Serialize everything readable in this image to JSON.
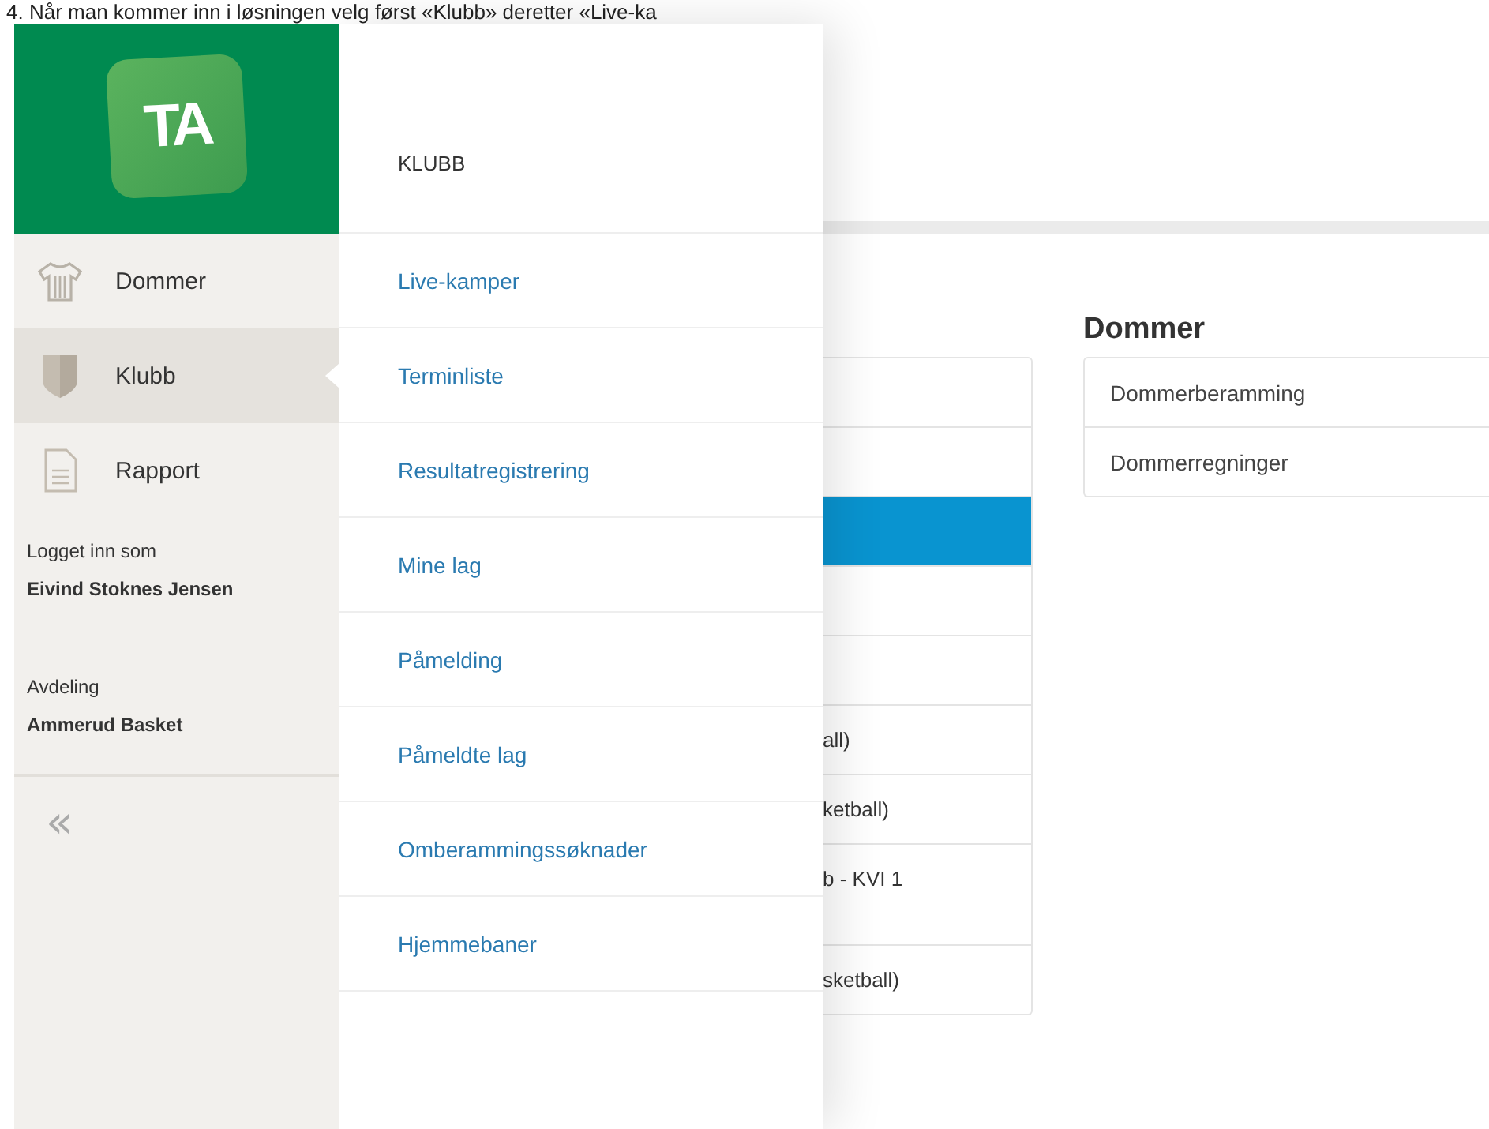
{
  "caption": "4. Når man kommer inn i løsningen velg først «Klubb» deretter «Live-ka",
  "logo": {
    "text": "TA"
  },
  "sidebar": {
    "items": [
      {
        "label": "Dommer",
        "selected": false
      },
      {
        "label": "Klubb",
        "selected": true
      },
      {
        "label": "Rapport",
        "selected": false
      }
    ],
    "user": {
      "label": "Logget inn som",
      "name": "Eivind Stoknes Jensen"
    },
    "department": {
      "label": "Avdeling",
      "name": "Ammerud Basket"
    },
    "collapse": "«"
  },
  "flyout": {
    "title": "KLUBB",
    "items": [
      "Live-kamper",
      "Terminliste",
      "Resultatregistrering",
      "Mine lag",
      "Påmelding",
      "Påmeldte lag",
      "Omberammingssøknader",
      "Hjemmebaner"
    ]
  },
  "list": {
    "rows": [
      {
        "text": "",
        "selected": false,
        "tall": false
      },
      {
        "text": "",
        "selected": false,
        "tall": false
      },
      {
        "text": "",
        "selected": true,
        "tall": false
      },
      {
        "text": "",
        "selected": false,
        "tall": false
      },
      {
        "text": "",
        "selected": false,
        "tall": false
      },
      {
        "text": "all)",
        "selected": false,
        "tall": false
      },
      {
        "text": "ketball)",
        "selected": false,
        "tall": false
      },
      {
        "text": "b - KVI 1",
        "selected": false,
        "tall": true
      },
      {
        "text": "sketball)",
        "selected": false,
        "tall": false
      }
    ]
  },
  "dommer": {
    "title": "Dommer",
    "items": [
      "Dommerberamming",
      "Dommerregninger"
    ]
  }
}
